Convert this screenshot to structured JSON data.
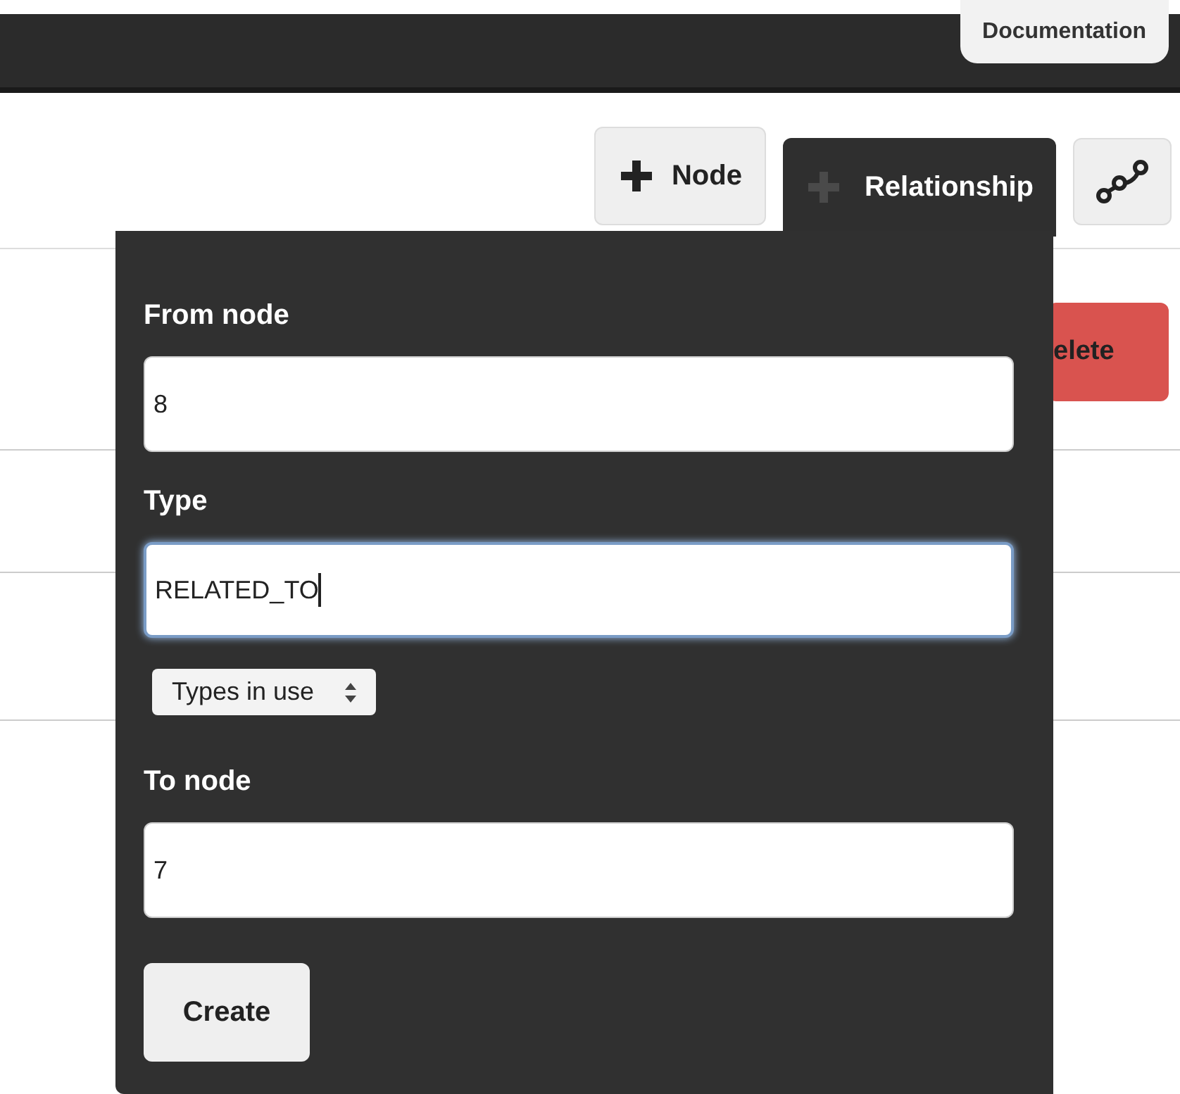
{
  "header": {
    "documentation_button": "Documentation"
  },
  "toolbar": {
    "tabs": [
      {
        "label": "Node",
        "selected": false
      },
      {
        "label": "Relationship",
        "selected": true
      }
    ]
  },
  "delete_button": "elete",
  "relationship_form": {
    "fields": [
      {
        "kind": "input",
        "label": "From node",
        "value": "8",
        "focused": false
      },
      {
        "kind": "input",
        "label": "Type",
        "value": "RELATED_TO",
        "focused": true
      },
      {
        "kind": "select",
        "value": "Types in use"
      },
      {
        "kind": "input",
        "label": "To node",
        "value": "7",
        "focused": false
      }
    ],
    "submit": "Create"
  }
}
